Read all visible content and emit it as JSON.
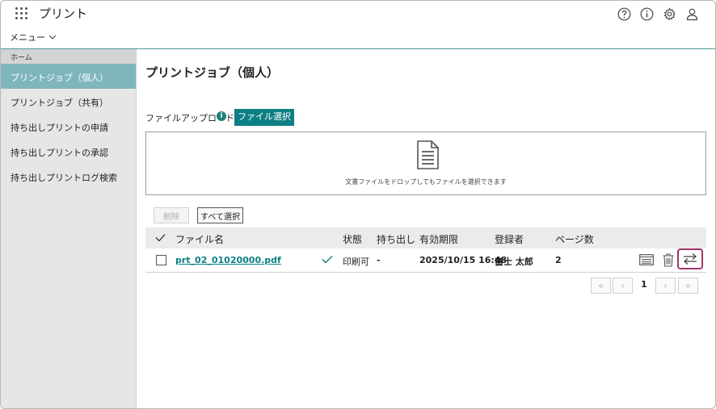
{
  "app": {
    "title": "プリント"
  },
  "menu": {
    "label": "メニュー"
  },
  "sidebar": {
    "home": "ホーム",
    "items": [
      {
        "label": "プリントジョブ（個人）"
      },
      {
        "label": "プリントジョブ（共有）"
      },
      {
        "label": "持ち出しプリントの申請"
      },
      {
        "label": "持ち出しプリントの承認"
      },
      {
        "label": "持ち出しプリントログ検索"
      }
    ]
  },
  "main": {
    "title": "プリントジョブ（個人）",
    "upload_label": "ファイルアップロード",
    "info_glyph": "i",
    "file_select": "ファイル選択",
    "drop_text": "文書ファイルをドロップしてもファイルを選択できます",
    "delete": "削除",
    "select_all": "すべて選択"
  },
  "table": {
    "headers": [
      "ファイル名",
      "状態",
      "持ち出し",
      "有効期限",
      "登録者",
      "ページ数"
    ],
    "rows": [
      {
        "file": "prt_02_01020000.pdf",
        "status": "印刷可",
        "takeout": "-",
        "expiry": "2025/10/15 16:48",
        "owner": "富士 太郎",
        "pages": "2"
      }
    ]
  },
  "pager": {
    "current": "1",
    "first": "«",
    "prev": "‹",
    "next": "›",
    "last": "»"
  },
  "colors": {
    "accent": "#0d7f83",
    "sidebar_active": "#7fb6bd",
    "highlight": "#a3356b"
  }
}
